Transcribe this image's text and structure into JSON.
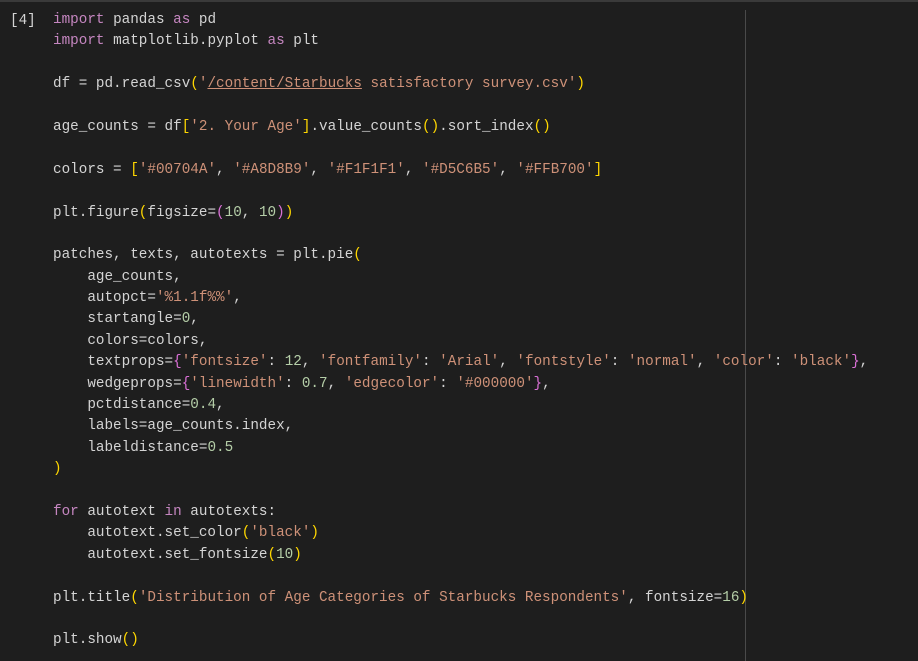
{
  "cell": {
    "execution_count": "[4]",
    "lines": [
      [
        [
          "kw",
          "import"
        ],
        [
          "plain",
          " pandas "
        ],
        [
          "kw",
          "as"
        ],
        [
          "plain",
          " pd"
        ]
      ],
      [
        [
          "kw",
          "import"
        ],
        [
          "plain",
          " matplotlib.pyplot "
        ],
        [
          "kw",
          "as"
        ],
        [
          "plain",
          " plt"
        ]
      ],
      [],
      [
        [
          "plain",
          "df = pd.read_csv"
        ],
        [
          "b1",
          "("
        ],
        [
          "str",
          "'"
        ],
        [
          "link",
          "/content/Starbucks"
        ],
        [
          "str",
          " satisfactory survey.csv'"
        ],
        [
          "b1",
          ")"
        ]
      ],
      [],
      [
        [
          "plain",
          "age_counts = df"
        ],
        [
          "b1",
          "["
        ],
        [
          "str",
          "'2. Your Age'"
        ],
        [
          "b1",
          "]"
        ],
        [
          "plain",
          ".value_counts"
        ],
        [
          "b1",
          "()"
        ],
        [
          "plain",
          ".sort_index"
        ],
        [
          "b1",
          "()"
        ]
      ],
      [],
      [
        [
          "plain",
          "colors = "
        ],
        [
          "b1",
          "["
        ],
        [
          "str",
          "'#00704A'"
        ],
        [
          "plain",
          ", "
        ],
        [
          "str",
          "'#A8D8B9'"
        ],
        [
          "plain",
          ", "
        ],
        [
          "str",
          "'#F1F1F1'"
        ],
        [
          "plain",
          ", "
        ],
        [
          "str",
          "'#D5C6B5'"
        ],
        [
          "plain",
          ", "
        ],
        [
          "str",
          "'#FFB700'"
        ],
        [
          "b1",
          "]"
        ]
      ],
      [],
      [
        [
          "plain",
          "plt.figure"
        ],
        [
          "b1",
          "("
        ],
        [
          "plain",
          "figsize="
        ],
        [
          "b2",
          "("
        ],
        [
          "num",
          "10"
        ],
        [
          "plain",
          ", "
        ],
        [
          "num",
          "10"
        ],
        [
          "b2",
          ")"
        ],
        [
          "b1",
          ")"
        ]
      ],
      [],
      [
        [
          "plain",
          "patches, texts, autotexts = plt.pie"
        ],
        [
          "b1",
          "("
        ]
      ],
      [
        [
          "plain",
          "    age_counts,"
        ]
      ],
      [
        [
          "plain",
          "    autopct="
        ],
        [
          "str",
          "'%1.1f%%'"
        ],
        [
          "plain",
          ","
        ]
      ],
      [
        [
          "plain",
          "    startangle="
        ],
        [
          "num",
          "0"
        ],
        [
          "plain",
          ","
        ]
      ],
      [
        [
          "plain",
          "    colors=colors,"
        ]
      ],
      [
        [
          "plain",
          "    textprops="
        ],
        [
          "b2",
          "{"
        ],
        [
          "str",
          "'fontsize'"
        ],
        [
          "plain",
          ": "
        ],
        [
          "num",
          "12"
        ],
        [
          "plain",
          ", "
        ],
        [
          "str",
          "'fontfamily'"
        ],
        [
          "plain",
          ": "
        ],
        [
          "str",
          "'Arial'"
        ],
        [
          "plain",
          ", "
        ],
        [
          "str",
          "'fontstyle'"
        ],
        [
          "plain",
          ": "
        ],
        [
          "str",
          "'normal'"
        ],
        [
          "plain",
          ", "
        ],
        [
          "str",
          "'color'"
        ],
        [
          "plain",
          ": "
        ],
        [
          "str",
          "'black'"
        ],
        [
          "b2",
          "}"
        ],
        [
          "plain",
          ","
        ]
      ],
      [
        [
          "plain",
          "    wedgeprops="
        ],
        [
          "b2",
          "{"
        ],
        [
          "str",
          "'linewidth'"
        ],
        [
          "plain",
          ": "
        ],
        [
          "num",
          "0.7"
        ],
        [
          "plain",
          ", "
        ],
        [
          "str",
          "'edgecolor'"
        ],
        [
          "plain",
          ": "
        ],
        [
          "str",
          "'#000000'"
        ],
        [
          "b2",
          "}"
        ],
        [
          "plain",
          ","
        ]
      ],
      [
        [
          "plain",
          "    pctdistance="
        ],
        [
          "num",
          "0.4"
        ],
        [
          "plain",
          ","
        ]
      ],
      [
        [
          "plain",
          "    labels=age_counts.index,"
        ]
      ],
      [
        [
          "plain",
          "    labeldistance="
        ],
        [
          "num",
          "0.5"
        ]
      ],
      [
        [
          "b1",
          ")"
        ]
      ],
      [],
      [
        [
          "kw",
          "for"
        ],
        [
          "plain",
          " autotext "
        ],
        [
          "kw",
          "in"
        ],
        [
          "plain",
          " autotexts:"
        ]
      ],
      [
        [
          "plain",
          "    autotext.set_color"
        ],
        [
          "b1",
          "("
        ],
        [
          "str",
          "'black'"
        ],
        [
          "b1",
          ")"
        ]
      ],
      [
        [
          "plain",
          "    autotext.set_fontsize"
        ],
        [
          "b1",
          "("
        ],
        [
          "num",
          "10"
        ],
        [
          "b1",
          ")"
        ]
      ],
      [],
      [
        [
          "plain",
          "plt.title"
        ],
        [
          "b1",
          "("
        ],
        [
          "str",
          "'Distribution of Age Categories of Starbucks Respondents'"
        ],
        [
          "plain",
          ", fontsize="
        ],
        [
          "num",
          "16"
        ],
        [
          "b1",
          ")"
        ]
      ],
      [],
      [
        [
          "plain",
          "plt.show"
        ],
        [
          "b1",
          "()"
        ]
      ]
    ]
  }
}
